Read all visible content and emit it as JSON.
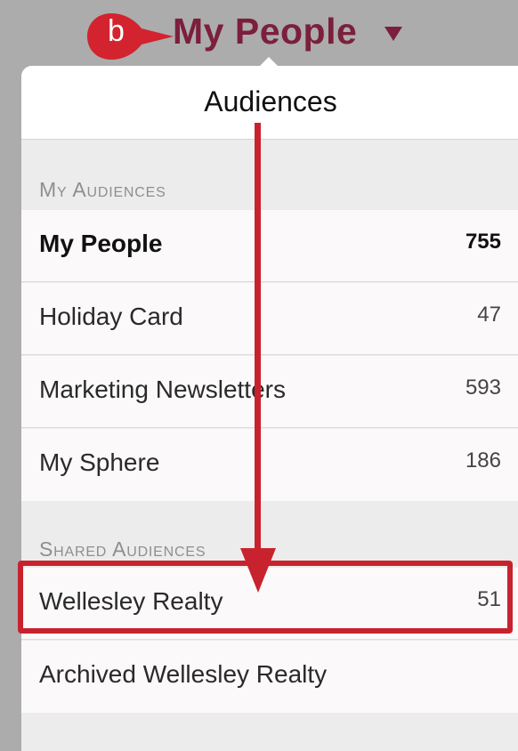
{
  "header": {
    "title": "My People",
    "step_letter": "b",
    "colors": {
      "brand": "#7b1f3c",
      "annotation": "#c8222e"
    }
  },
  "popover": {
    "title": "Audiences",
    "sections": [
      {
        "heading": "My Audiences",
        "items": [
          {
            "label": "My People",
            "count": "755",
            "selected": true
          },
          {
            "label": "Holiday Card",
            "count": "47"
          },
          {
            "label": "Marketing Newsletters",
            "count": "593"
          },
          {
            "label": "My Sphere",
            "count": "186"
          }
        ]
      },
      {
        "heading": "Shared Audiences",
        "items": [
          {
            "label": "Wellesley Realty",
            "count": "51",
            "highlighted": true
          },
          {
            "label": "Archived Wellesley Realty",
            "count": ""
          }
        ]
      }
    ]
  }
}
